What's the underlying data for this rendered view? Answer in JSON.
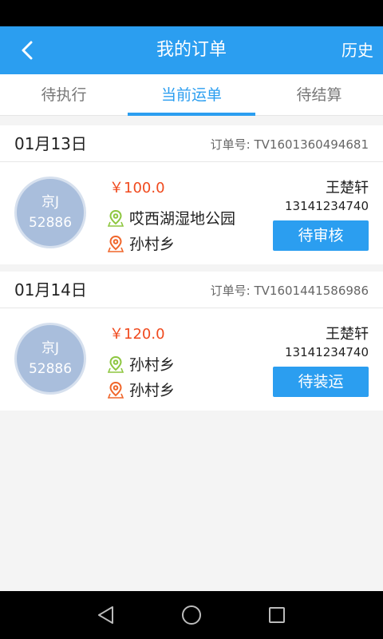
{
  "app_bar": {
    "back_icon": "chevron-left-icon",
    "title": "我的订单",
    "history_label": "历史",
    "color": "#2b9ef0"
  },
  "tabs": [
    {
      "label": "待执行",
      "active": false
    },
    {
      "label": "当前运单",
      "active": true
    },
    {
      "label": "待结算",
      "active": false
    }
  ],
  "orders": [
    {
      "date": "01月13日",
      "order_no_label": "订单号:",
      "order_no": "TV1601360494681",
      "plate_line1": "京J",
      "plate_line2": "52886",
      "price": "￥100.0",
      "from": "哎西湖湿地公园",
      "to": "孙村乡",
      "driver_name": "王楚轩",
      "phone": "13141234740",
      "status": "待审核"
    },
    {
      "date": "01月14日",
      "order_no_label": "订单号:",
      "order_no": "TV1601441586986",
      "plate_line1": "京J",
      "plate_line2": "52886",
      "price": "￥120.0",
      "from": "孙村乡",
      "to": "孙村乡",
      "driver_name": "王楚轩",
      "phone": "13141234740",
      "status": "待装运"
    }
  ],
  "icons": {
    "origin": "location-pin-green-icon",
    "destination": "location-pin-orange-icon"
  },
  "colors": {
    "accent": "#2b9ef0",
    "price": "#f04a1e",
    "origin_pin": "#8dc63f",
    "destination_pin": "#f0662a"
  },
  "nav_bar": {
    "icons": [
      "back-triangle-icon",
      "home-circle-icon",
      "recents-square-icon"
    ]
  }
}
